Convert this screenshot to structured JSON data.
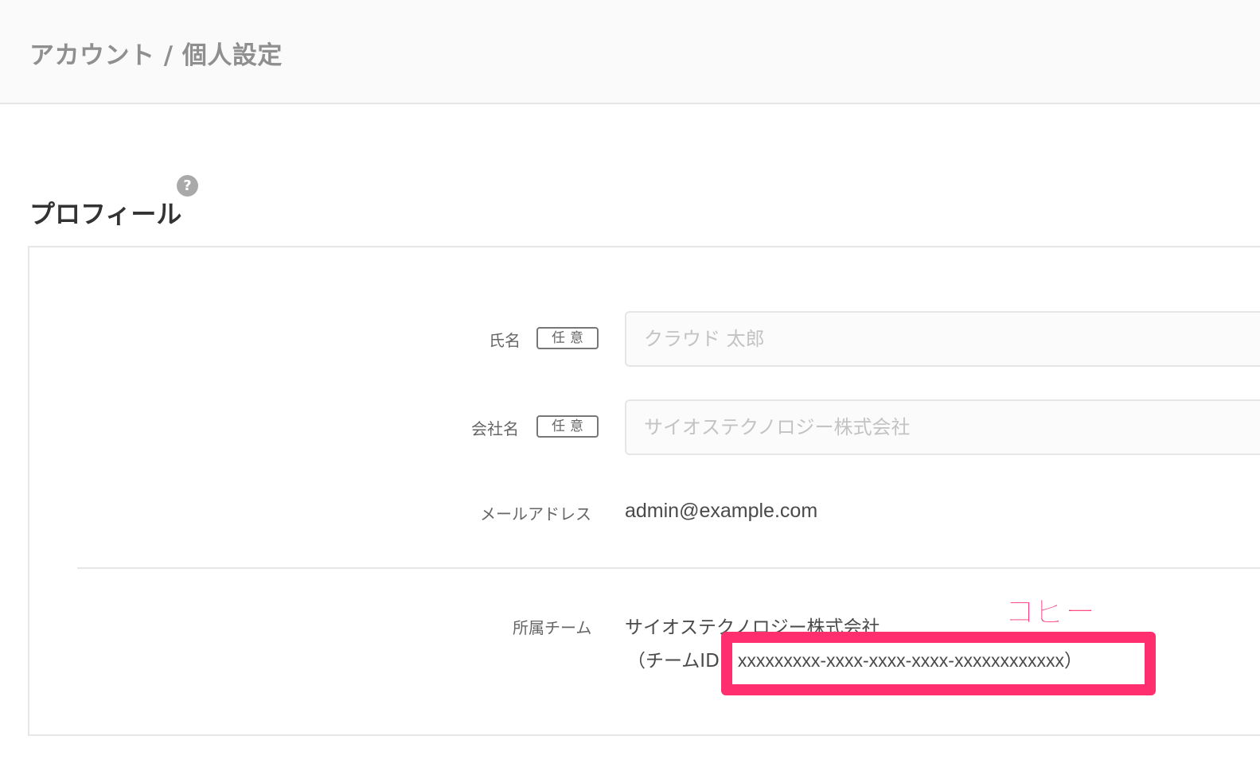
{
  "header": {
    "breadcrumb": "アカウント / 個人設定"
  },
  "profile": {
    "section_title": "プロフィール",
    "help_icon_glyph": "?",
    "fields": {
      "name": {
        "label": "氏名",
        "badge": "任意",
        "placeholder": "クラウド 太郎"
      },
      "company": {
        "label": "会社名",
        "badge": "任意",
        "placeholder": "サイオステクノロジー株式会社"
      },
      "email": {
        "label": "メールアドレス",
        "value": "admin@example.com"
      },
      "team": {
        "label": "所属チーム",
        "name": "サイオステクノロジー株式会社",
        "id_prefix": "（チームID：",
        "id_value": "xxxxxxxxx-xxxx-xxxx-xxxx-xxxxxxxxxxxx",
        "id_suffix": "）"
      }
    }
  },
  "annotation": {
    "text": "コピー",
    "color": "#ff2e6e"
  },
  "colors": {
    "highlight": "#ff2e6e",
    "header_bg": "#fafafa",
    "border": "#e6e6e6"
  }
}
